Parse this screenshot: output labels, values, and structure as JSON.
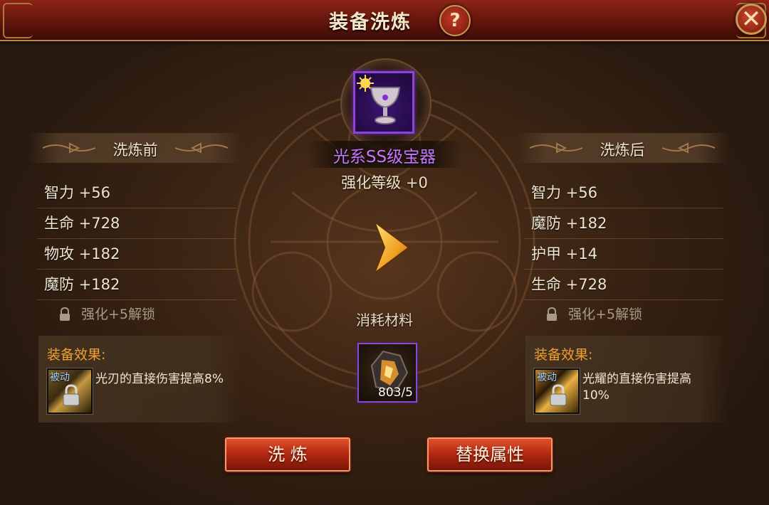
{
  "dialog": {
    "title": "装备洗炼",
    "help_symbol": "?",
    "close_symbol": "✕"
  },
  "equipment": {
    "name": "光系SS级宝器",
    "enhance_level": "强化等级 +0",
    "icon": "chalice-icon",
    "name_color": "#c776ff"
  },
  "before": {
    "header": "洗炼前",
    "stats": [
      "智力 +56",
      "生命 +728",
      "物攻 +182",
      "魔防 +182"
    ],
    "locked": "强化+5解锁",
    "effect_title": "装备效果:",
    "skill_tag": "被动",
    "effect_desc": "光刃的直接伤害提高8%"
  },
  "after": {
    "header": "洗炼后",
    "stats": [
      "智力 +56",
      "魔防 +182",
      "护甲 +14",
      "生命 +728"
    ],
    "locked": "强化+5解锁",
    "effect_title": "装备效果:",
    "skill_tag": "被动",
    "effect_desc": "光耀的直接伤害提高10%"
  },
  "cost": {
    "label": "消耗材料",
    "material_icon": "refine-stone-icon",
    "count": "803/5"
  },
  "buttons": {
    "refine": "洗 炼",
    "replace": "替换属性"
  },
  "colors": {
    "title_bar": "#7a1c10",
    "effect_title": "#f0a030",
    "rarity_border": "#8d43d6",
    "button": "#c0341a"
  }
}
